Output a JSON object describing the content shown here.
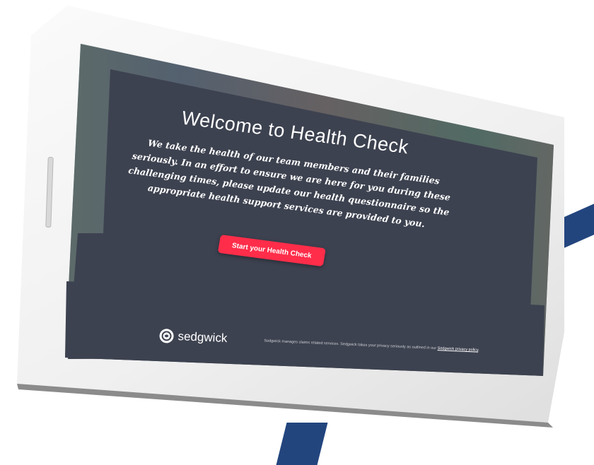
{
  "page": {
    "title": "Welcome to Health Check",
    "body": "We take the health of our team members and their families seriously. In an effort to ensure we are here for you during these challenging times, please update our health questionnaire so the appropriate health support services are provided to you.",
    "cta_label": "Start your Health Check"
  },
  "footer": {
    "brand": "sedgwick",
    "text_before": "Sedgwick manages claims related services. Sedgwick takes your privacy seriously as outlined in our ",
    "link_text": "Sedgwick privacy policy",
    "text_after": "."
  },
  "icons": {
    "logo": "sedgwick-logo-icon"
  },
  "colors": {
    "panel": "#3d4250",
    "cta": "#ff2d4a",
    "accent_blue": "#23457e"
  }
}
